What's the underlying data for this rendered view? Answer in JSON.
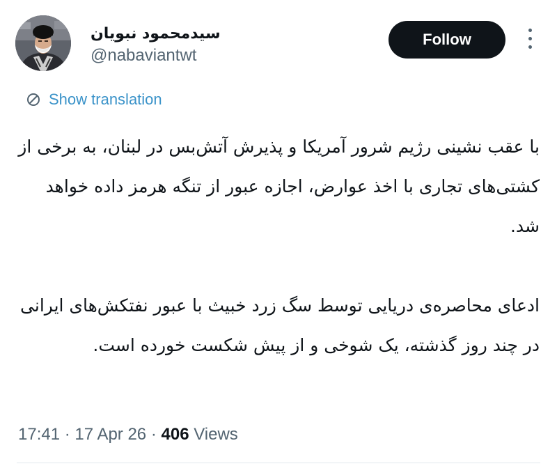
{
  "author": {
    "display_name": "سیدمحمود نبویان",
    "handle": "@nabaviantwt",
    "avatar_icon": "profile-photo"
  },
  "actions": {
    "follow_label": "Follow",
    "more_icon": "more-vertical-icon"
  },
  "translation": {
    "icon": "translate-icon",
    "label": "Show translation",
    "color": "#3b93c9"
  },
  "tweet": {
    "paragraphs": [
      "با عقب نشینی رژیم شرور آمریکا و پذیرش آتش‌بس در لبنان، به برخی از کشتی‌های تجاری با اخذ عوارض،  اجازه عبور از تنگه هرمز داده خواهد شد.",
      "ادعای محاصره‌ی دریایی توسط سگ زرد خبیث با عبور نفتکش‌های ایرانی در چند روز گذشته،  یک شوخی و از پیش شکست خورده است."
    ]
  },
  "meta": {
    "time": "17:41",
    "separator": "·",
    "date": "17 Apr 26",
    "views_count": "406",
    "views_label": "Views"
  },
  "colors": {
    "primary_text": "#0f1419",
    "secondary_text": "#536471",
    "follow_bg": "#0f1419"
  }
}
